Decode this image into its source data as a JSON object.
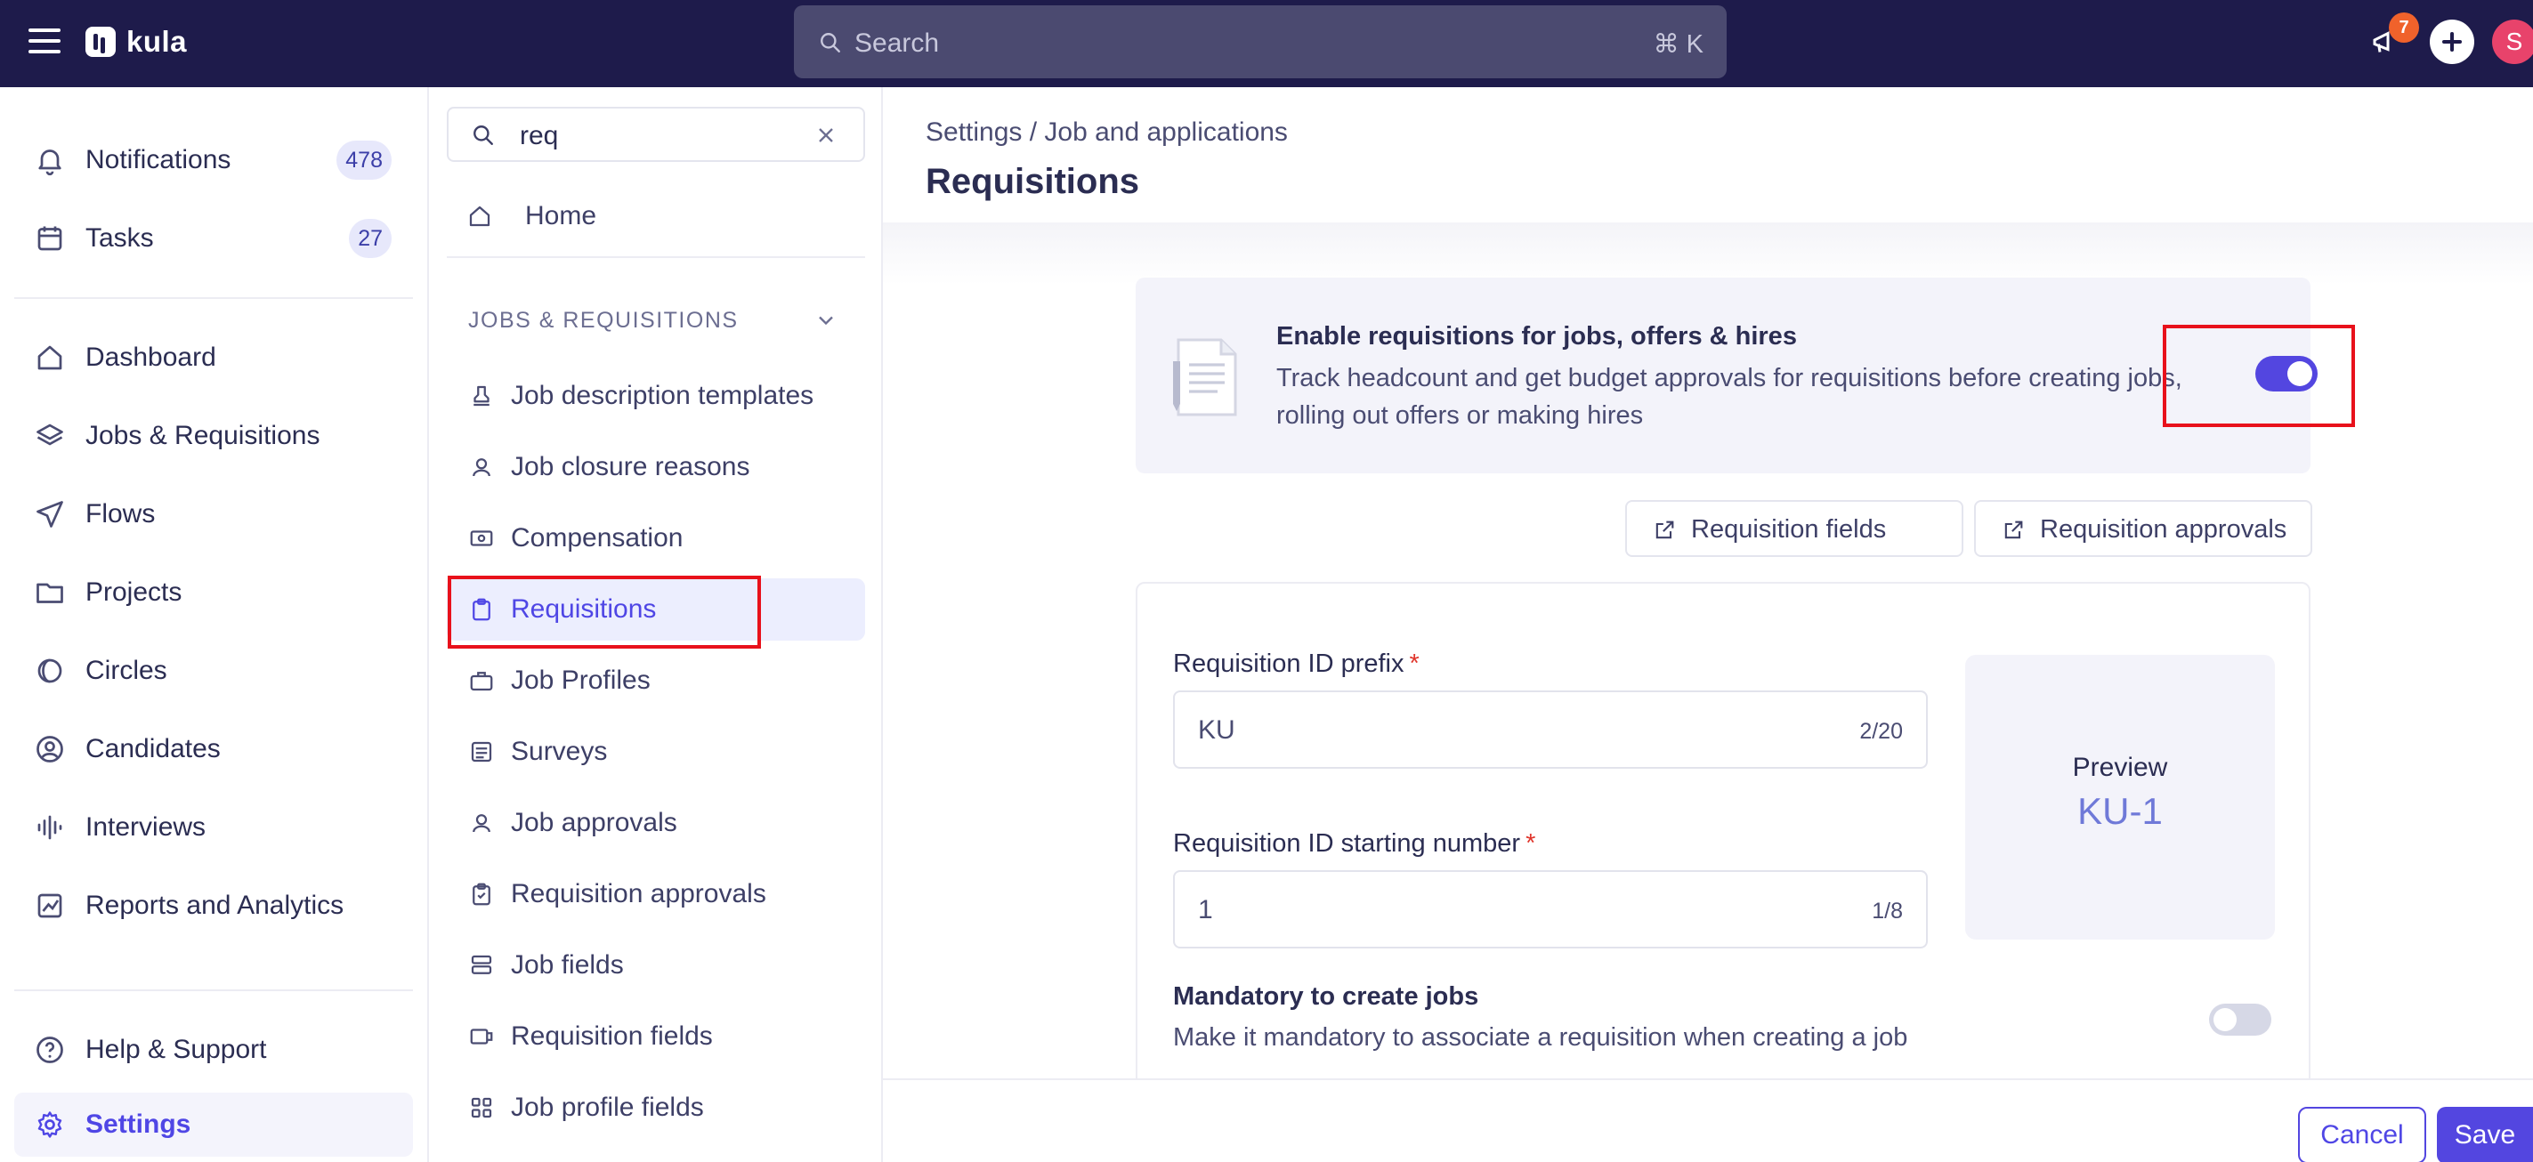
{
  "topbar": {
    "brand": "kula",
    "search_placeholder": "Search",
    "search_shortcut": "⌘ K",
    "announcement_count": "7",
    "avatar_initial": "S"
  },
  "sidebar": {
    "items": [
      {
        "label": "Notifications",
        "icon": "bell-icon",
        "count": "478"
      },
      {
        "label": "Tasks",
        "icon": "calendar-icon",
        "count": "27"
      },
      {
        "label": "Dashboard",
        "icon": "home-icon"
      },
      {
        "label": "Jobs & Requisitions",
        "icon": "layers-icon"
      },
      {
        "label": "Flows",
        "icon": "send-icon"
      },
      {
        "label": "Projects",
        "icon": "folder-icon"
      },
      {
        "label": "Circles",
        "icon": "circles-icon"
      },
      {
        "label": "Candidates",
        "icon": "user-circle-icon"
      },
      {
        "label": "Interviews",
        "icon": "audio-wave-icon"
      },
      {
        "label": "Reports and Analytics",
        "icon": "chart-icon"
      },
      {
        "label": "Help & Support",
        "icon": "help-icon"
      },
      {
        "label": "Settings",
        "icon": "gear-icon"
      }
    ]
  },
  "subnav": {
    "filter_value": "req",
    "home_label": "Home",
    "section_title": "JOBS & REQUISITIONS",
    "items": [
      {
        "label": "Job description templates",
        "icon": "stamp-icon"
      },
      {
        "label": "Job closure reasons",
        "icon": "user-x-icon"
      },
      {
        "label": "Compensation",
        "icon": "money-icon"
      },
      {
        "label": "Requisitions",
        "icon": "clipboard-icon"
      },
      {
        "label": "Job Profiles",
        "icon": "briefcase-icon"
      },
      {
        "label": "Surveys",
        "icon": "list-icon"
      },
      {
        "label": "Job approvals",
        "icon": "user-check-icon"
      },
      {
        "label": "Requisition approvals",
        "icon": "clipboard-check-icon"
      },
      {
        "label": "Job fields",
        "icon": "stack-icon"
      },
      {
        "label": "Requisition fields",
        "icon": "tag-icon"
      },
      {
        "label": "Job profile fields",
        "icon": "grid-icon"
      }
    ]
  },
  "main": {
    "breadcrumb": "Settings / Job and applications",
    "title": "Requisitions",
    "enable": {
      "title": "Enable requisitions for jobs, offers & hires",
      "description": "Track headcount and get budget approvals for requisitions before creating jobs, rolling out offers or making hires",
      "enabled": true
    },
    "links": {
      "fields_label": "Requisition fields",
      "approvals_label": "Requisition approvals"
    },
    "form": {
      "prefix_label": "Requisition ID prefix",
      "prefix_value": "KU",
      "prefix_count": "2/20",
      "start_label": "Requisition ID starting number",
      "start_value": "1",
      "start_count": "1/8",
      "required_mark": "*",
      "preview_label": "Preview",
      "preview_value": "KU-1",
      "mandatory_title": "Mandatory to create jobs",
      "mandatory_desc": "Make it mandatory to associate a requisition when creating a job",
      "mandatory_enabled": false
    },
    "footer": {
      "cancel_label": "Cancel",
      "save_label": "Save"
    }
  },
  "colors": {
    "topbar_bg": "#1e1b4b",
    "accent": "#5346e0",
    "highlight": "#e8111b"
  }
}
